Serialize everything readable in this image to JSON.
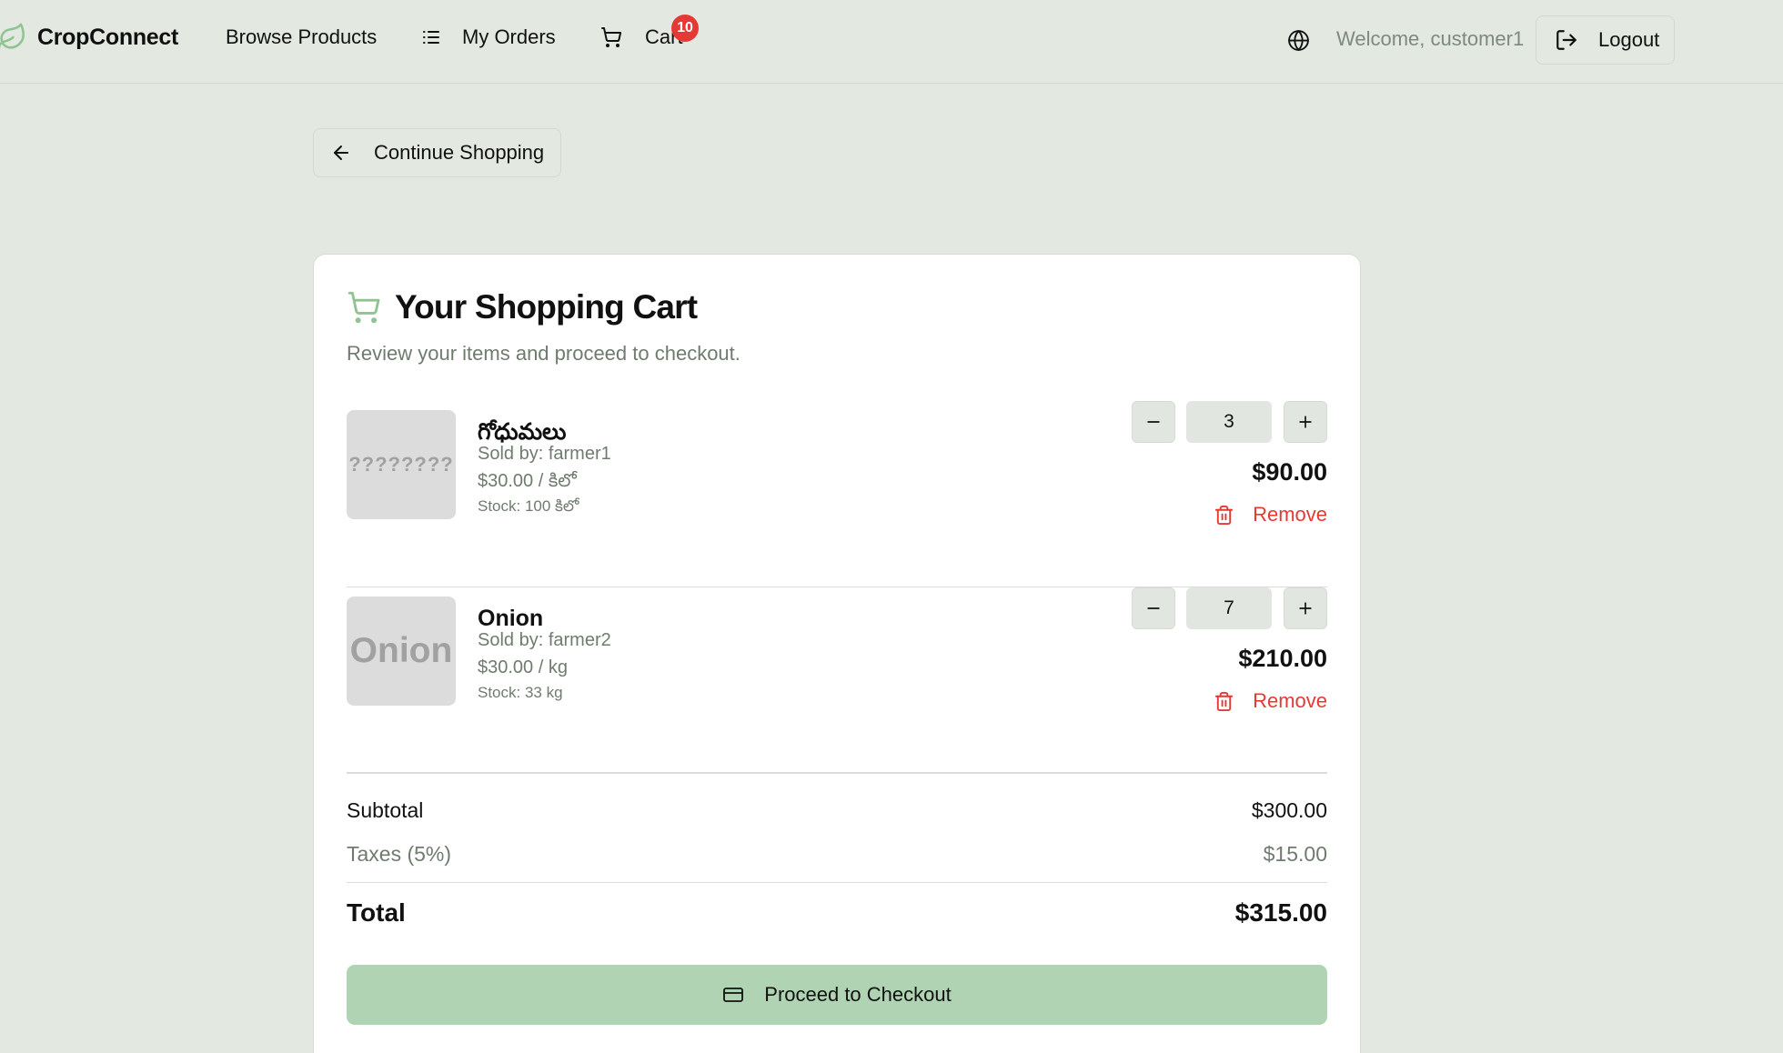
{
  "brand": {
    "name": "CropConnect",
    "logo_icon": "leaf-icon"
  },
  "nav": {
    "browse_label": "Browse Products",
    "orders_label": "My Orders",
    "cart_label": "Cart",
    "cart_count": "10",
    "welcome": "Welcome, customer1",
    "logout_label": "Logout"
  },
  "continue_label": "Continue Shopping",
  "cart": {
    "title": "Your Shopping Cart",
    "subtitle": "Review your items and proceed to checkout.",
    "items": [
      {
        "thumb_text": "????????",
        "name": "గోధుమలు",
        "seller": "Sold by: farmer1",
        "price": "$30.00 / కిలో",
        "stock": "Stock: 100 కిలో",
        "quantity": "3",
        "line_total": "$90.00",
        "remove_label": "Remove"
      },
      {
        "thumb_text": "Onion",
        "name": "Onion",
        "seller": "Sold by: farmer2",
        "price": "$30.00 / kg",
        "stock": "Stock: 33 kg",
        "quantity": "7",
        "line_total": "$210.00",
        "remove_label": "Remove"
      }
    ],
    "summary": {
      "subtotal_label": "Subtotal",
      "subtotal_value": "$300.00",
      "tax_label": "Taxes (5%)",
      "tax_value": "$15.00",
      "total_label": "Total",
      "total_value": "$315.00"
    },
    "checkout_label": "Proceed to Checkout"
  },
  "colors": {
    "background": "#e3e8e1",
    "accent_green": "#b0d4b3",
    "danger_red": "#e53935",
    "badge_red": "#e53935",
    "muted_text": "#6f7b6e"
  }
}
